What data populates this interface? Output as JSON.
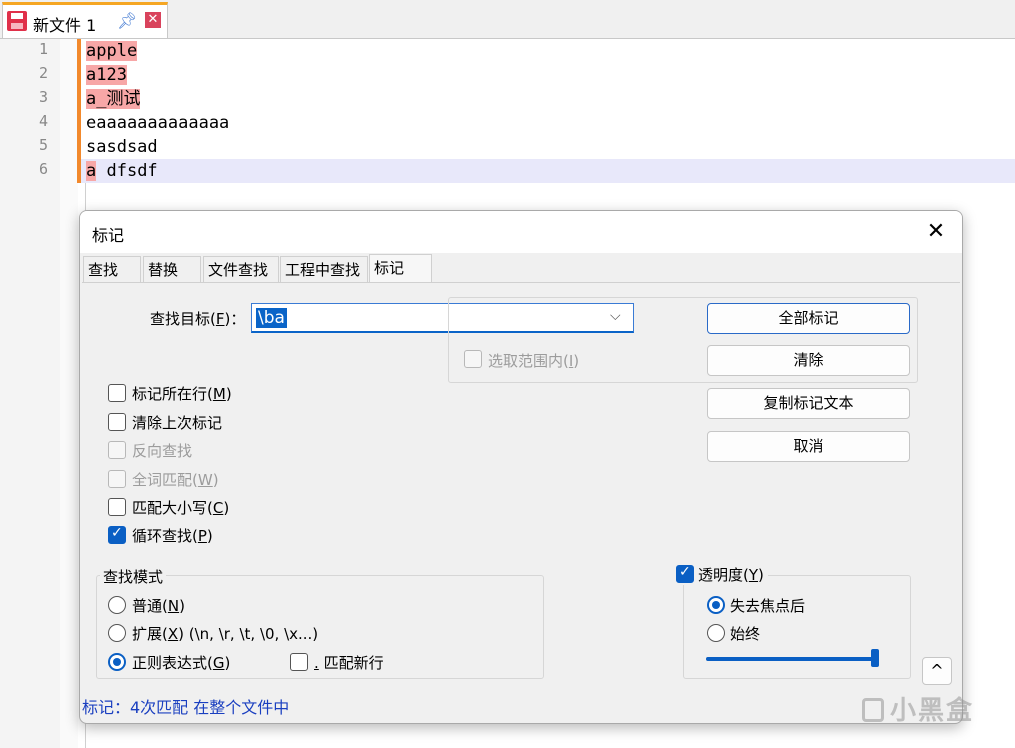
{
  "tab": {
    "title": "新文件 1"
  },
  "editor": {
    "line_numbers": [
      "1",
      "2",
      "3",
      "4",
      "5",
      "6"
    ],
    "lines": [
      {
        "marked": "apple",
        "rest": ""
      },
      {
        "marked": "a123",
        "rest": ""
      },
      {
        "marked": "a_测试",
        "rest": ""
      },
      {
        "marked": "",
        "rest": "eaaaaaaaaaaaaa"
      },
      {
        "marked": "",
        "rest": "sasdsad"
      },
      {
        "marked": "a",
        "rest": " dfsdf"
      }
    ],
    "mark_color": "#f7a7a7",
    "current_line_color": "#e8e8fa",
    "change_bar_color": "#f2892c"
  },
  "dialog": {
    "title": "标记",
    "tabs": [
      "查找",
      "替换",
      "文件查找",
      "工程中查找",
      "标记"
    ],
    "active_tab": "标记",
    "find_label": "查找目标(",
    "find_label_key": "F",
    "find_label_end": ")：",
    "find_value": "\\ba",
    "in_selection": {
      "label": "选取范围内(",
      "key": "I",
      "end": ")",
      "checked": false,
      "enabled": false
    },
    "buttons": {
      "mark_all": "全部标记",
      "clear": "清除",
      "copy": "复制标记文本",
      "cancel": "取消"
    },
    "options": [
      {
        "label": "标记所在行(",
        "key": "M",
        "end": ")",
        "checked": false,
        "enabled": true
      },
      {
        "label": "清除上次标记",
        "key": "",
        "end": "",
        "checked": false,
        "enabled": true
      },
      {
        "label": "反向查找",
        "key": "",
        "end": "",
        "checked": false,
        "enabled": false
      },
      {
        "label": "全词匹配(",
        "key": "W",
        "end": ")",
        "checked": false,
        "enabled": false
      },
      {
        "label": "匹配大小写(",
        "key": "C",
        "end": ")",
        "checked": false,
        "enabled": true
      },
      {
        "label": "循环查找(",
        "key": "P",
        "end": ")",
        "checked": true,
        "enabled": true
      }
    ],
    "search_mode": {
      "caption": "查找模式",
      "normal": {
        "label": "普通(",
        "key": "N",
        "end": ")",
        "selected": false
      },
      "extended": {
        "label": "扩展(",
        "key": "X",
        "end": ") (\\n, \\r, \\t, \\0, \\x...)",
        "selected": false
      },
      "regex": {
        "label": "正则表达式(",
        "key": "G",
        "end": ")",
        "selected": true
      },
      "dot_newline": {
        "label": "匹配新行",
        "key": ".",
        "checked": false
      }
    },
    "transparency": {
      "caption": "透明度(",
      "key": "Y",
      "end": ")",
      "checked": true,
      "on_lose_focus": "失去焦点后",
      "always": "始终",
      "selected": "on_lose_focus",
      "level": 0.98
    },
    "collapse_label": "^",
    "status_text": "标记：4次匹配 在整个文件中",
    "accent_color": "#0a5fc4"
  },
  "watermark": "小黑盒"
}
